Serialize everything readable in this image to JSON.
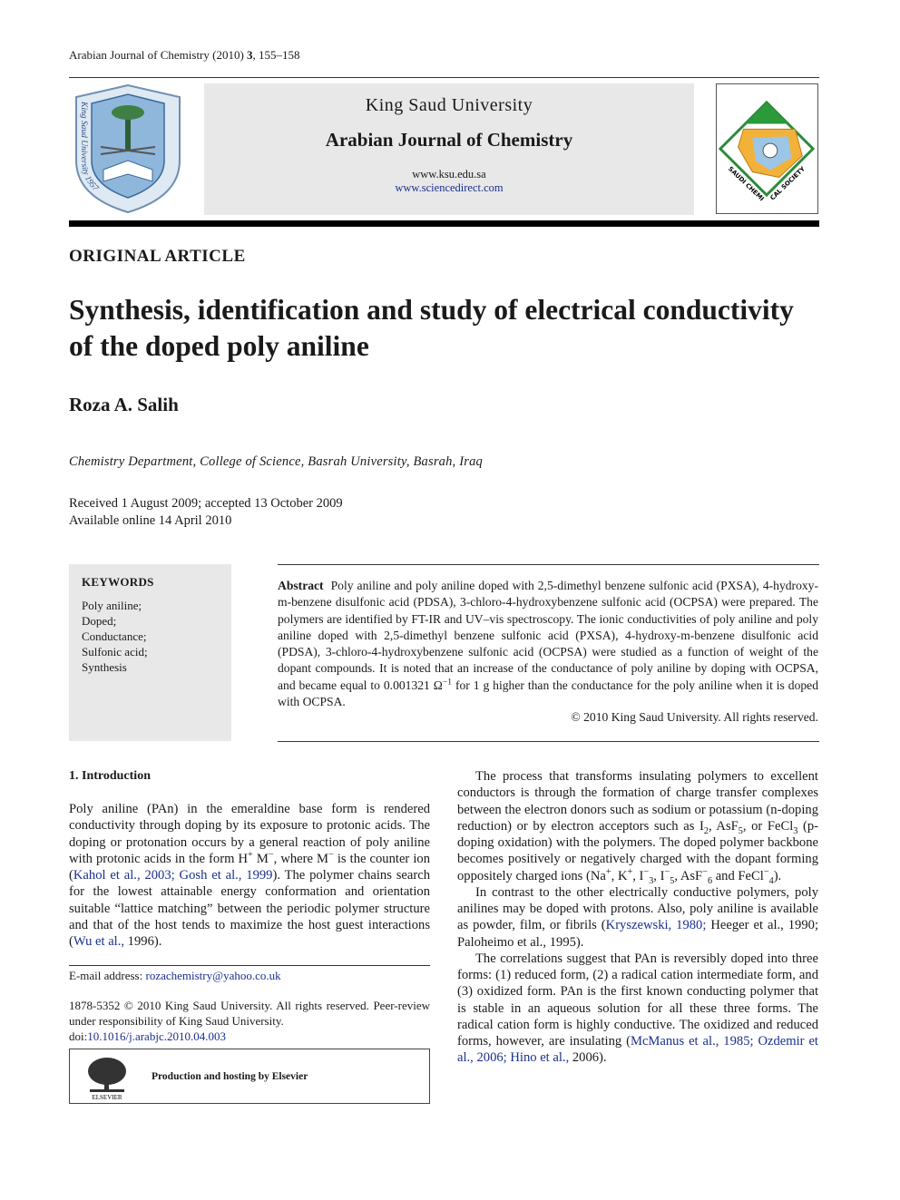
{
  "running_head": {
    "journal": "Arabian Journal of Chemistry (2010) ",
    "volume": "3",
    "pages": ", 155–158"
  },
  "header": {
    "university": "King Saud University",
    "journal": "Arabian Journal of Chemistry",
    "website1": "www.ksu.edu.sa",
    "website2": "www.sciencedirect.com",
    "ksu_logo_text": "King Saud University 1957",
    "society_logo_text": "SAUDI CHEMICAL SOCIETY"
  },
  "article_type": "ORIGINAL ARTICLE",
  "title": "Synthesis, identification and study of electrical conductivity of the doped poly aniline",
  "author": "Roza A. Salih",
  "affiliation": "Chemistry Department, College of Science, Basrah University, Basrah, Iraq",
  "dates": {
    "received": "Received 1 August 2009; accepted 13 October 2009",
    "online": "Available online 14 April 2010"
  },
  "keywords": {
    "heading": "KEYWORDS",
    "items": [
      "Poly aniline;",
      "Doped;",
      "Conductance;",
      "Sulfonic acid;",
      "Synthesis"
    ]
  },
  "abstract": {
    "label": "Abstract",
    "text1": "Poly aniline and poly aniline doped with 2,5-dimethyl benzene sulfonic acid (PXSA), 4-hydroxy-m-benzene disulfonic acid (PDSA), 3-chloro-4-hydroxybenzene sulfonic acid (OCPSA) were prepared. The polymers are identified by FT-IR and UV–vis spectroscopy. The ionic conductivities of poly aniline and poly aniline doped with 2,5-dimethyl benzene sulfonic acid (PXSA), 4-hydroxy-m-benzene disulfonic acid (PDSA), 3-chloro-4-hydroxybenzene sulfonic acid (OCPSA) were studied as a function of weight of the dopant compounds. It is noted that an increase of the conductance of poly aniline by doping with OCPSA, and became equal to 0.001321 Ω",
    "sup": "−1",
    "text2": " for 1 g higher than the conductance for the poly aniline when it is doped with OCPSA.",
    "copyright": "© 2010 King Saud University. All rights reserved."
  },
  "intro": {
    "heading": "1. Introduction",
    "left": [
      [
        {
          "t": "Poly aniline (PAn) in the emeraldine base form is rendered conductivity through doping by its exposure to protonic acids. The doping or protonation occurs by a general reaction of poly aniline with protonic acids in the form H"
        },
        {
          "t": "+",
          "c": "sup"
        },
        {
          "t": " M"
        },
        {
          "t": "−",
          "c": "sup"
        },
        {
          "t": ", where M"
        },
        {
          "t": "−",
          "c": "sup"
        },
        {
          "t": " is the counter ion ("
        },
        {
          "t": "Kahol et al., 2003; Gosh et al., 1999",
          "c": "link"
        },
        {
          "t": "). The polymer chains search for the lowest attainable energy conformation and orientation suitable “lattice matching” between the periodic polymer structure and that of the host tends to maximize the host guest interactions ("
        },
        {
          "t": "Wu et al.,",
          "c": "link"
        },
        {
          "t": " 1996)."
        }
      ]
    ],
    "right": [
      [
        {
          "t": "The process that transforms insulating polymers to excellent conductors is through the formation of charge transfer complexes between the electron donors such as sodium or potassium (n-doping reduction) or by electron acceptors such as I"
        },
        {
          "t": "2",
          "c": "sub"
        },
        {
          "t": ", AsF"
        },
        {
          "t": "5",
          "c": "sub"
        },
        {
          "t": ", or FeCl"
        },
        {
          "t": "3",
          "c": "sub"
        },
        {
          "t": " (p-doping oxidation) with the polymers. The doped polymer backbone becomes positively or negatively charged with the dopant forming oppositely charged ions (Na"
        },
        {
          "t": "+",
          "c": "sup"
        },
        {
          "t": ", K"
        },
        {
          "t": "+",
          "c": "sup"
        },
        {
          "t": ", I"
        },
        {
          "t": "−",
          "c": "sup"
        },
        {
          "t": "3",
          "c": "sub"
        },
        {
          "t": ", I"
        },
        {
          "t": "−",
          "c": "sup"
        },
        {
          "t": "5",
          "c": "sub"
        },
        {
          "t": ", AsF"
        },
        {
          "t": "−",
          "c": "sup"
        },
        {
          "t": "6",
          "c": "sub"
        },
        {
          "t": " and FeCl"
        },
        {
          "t": "−",
          "c": "sup"
        },
        {
          "t": "4",
          "c": "sub"
        },
        {
          "t": ")."
        }
      ],
      [
        {
          "t": "In contrast to the other electrically conductive polymers, poly anilines may be doped with protons. Also, poly aniline is available as powder, film, or fibrils ("
        },
        {
          "t": "Kryszewski, 1980;",
          "c": "link"
        },
        {
          "t": " Heeger et al., 1990; Paloheimo et al., 1995)."
        }
      ],
      [
        {
          "t": "The correlations suggest that PAn is reversibly doped into three forms: (1) reduced form, (2) a radical cation intermediate form, and (3) oxidized form. PAn is the first known conducting polymer that is stable in an aqueous solution for all these three forms. The radical cation form is highly conductive. The oxidized and reduced forms, however, are insulating ("
        },
        {
          "t": "McManus et al., 1985; Ozdemir et al., 2006; Hino et al.,",
          "c": "link"
        },
        {
          "t": " 2006)."
        }
      ]
    ]
  },
  "footnote": {
    "email_label": "E-mail address: ",
    "email": "rozachemistry@yahoo.co.uk",
    "issn": "1878-5352 © 2010 King Saud University. All rights reserved. Peer-review under responsibility of King Saud University.",
    "doi_label": "doi:",
    "doi": "10.1016/j.arabjc.2010.04.003"
  },
  "elsevier": {
    "text": "Production and hosting by Elsevier",
    "logo_text": "ELSEVIER"
  },
  "colors": {
    "link": "#1a2f8f",
    "band": "#e8e8e8"
  }
}
